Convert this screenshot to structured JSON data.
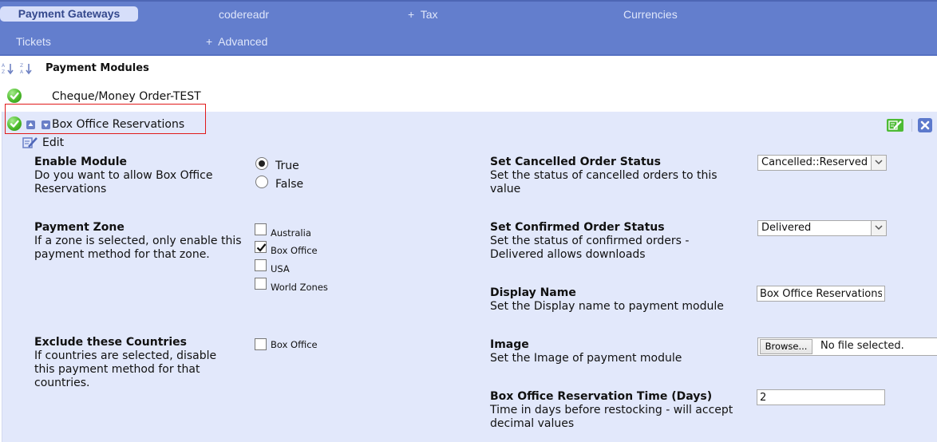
{
  "nav": {
    "row1": [
      "Payment Gateways",
      "codereadr",
      "+  Tax",
      "Currencies"
    ],
    "row2": [
      "Tickets",
      "+  Advanced"
    ],
    "active": "Payment Gateways"
  },
  "header": {
    "title": "Payment Modules",
    "sort_asc_icon": "sort-alpha-asc-icon",
    "sort_desc_icon": "sort-alpha-desc-icon"
  },
  "modules": [
    {
      "name": "Cheque/Money Order-TEST",
      "status": "enabled"
    },
    {
      "name": "Box Office Reservations",
      "status": "enabled",
      "expanded": true
    }
  ],
  "panel": {
    "edit_label": "Edit",
    "actions": {
      "edit_icon": "edit-icon",
      "close_icon": "close-icon"
    }
  },
  "settings": {
    "enable_module": {
      "title": "Enable Module",
      "desc": "Do you want to allow Box Office Reservations",
      "options": [
        "True",
        "False"
      ],
      "selected": "True"
    },
    "payment_zone": {
      "title": "Payment Zone",
      "desc": "If a zone is selected, only enable this payment method for that zone.",
      "options": [
        {
          "label": "Australia",
          "checked": false
        },
        {
          "label": "Box Office",
          "checked": true
        },
        {
          "label": "USA",
          "checked": false
        },
        {
          "label": "World Zones",
          "checked": false
        }
      ]
    },
    "exclude_countries": {
      "title": "Exclude these Countries",
      "desc": "If countries are selected, disable this payment method for that countries.",
      "options": [
        {
          "label": "Box Office",
          "checked": false
        }
      ]
    },
    "cancelled_status": {
      "title": "Set Cancelled Order Status",
      "desc": "Set the status of cancelled orders to this value",
      "value": "Cancelled::Reserved"
    },
    "confirmed_status": {
      "title": "Set Confirmed Order Status",
      "desc": "Set the status of confirmed orders - Delivered allows downloads",
      "value": "Delivered"
    },
    "display_name": {
      "title": "Display Name",
      "desc": "Set the Display name to payment module",
      "value": "Box Office Reservations"
    },
    "image": {
      "title": "Image",
      "desc": "Set the Image of payment module",
      "browse_label": "Browse...",
      "file_status": "No file selected."
    },
    "reservation_time": {
      "title": "Box Office Reservation Time (Days)",
      "desc": "Time in days before restocking - will accept decimal values",
      "value": "2"
    }
  },
  "colors": {
    "nav_bg": "#637ecd",
    "nav_active_bg": "#d6defa",
    "panel_bg": "#e2e8fb",
    "highlight": "#e11a1a",
    "enabled_green": "#4cbb2a"
  }
}
